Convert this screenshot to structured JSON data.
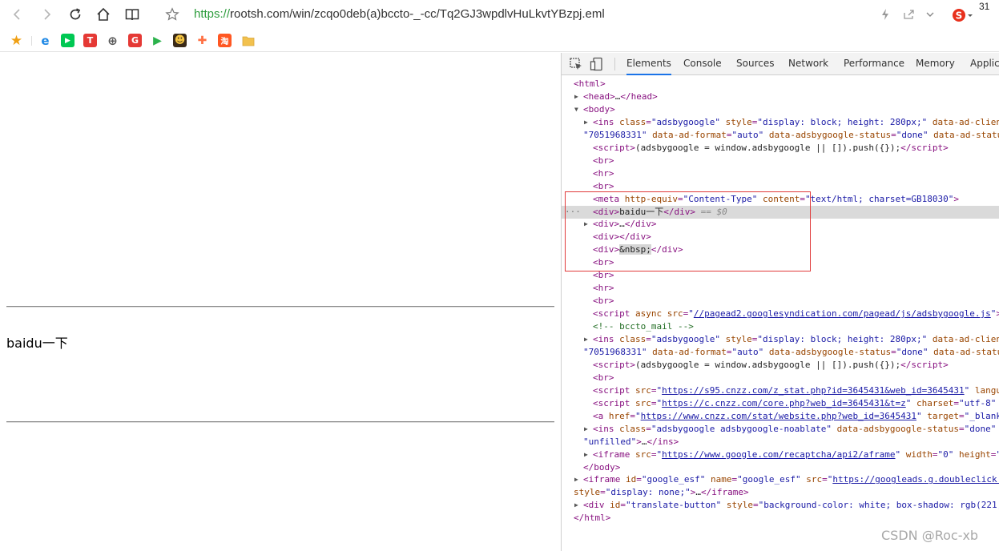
{
  "toolbar": {
    "url_scheme": "https://",
    "url_rest": "rootsh.com/win/zcqo0deb(a)bccto-_-cc/Tq2GJ3wpdlvHuLkvtYBzpj.eml",
    "date_fragment": "31",
    "icons": [
      "back-icon",
      "forward-icon",
      "reload-icon",
      "home-icon",
      "reader-icon",
      "star-icon",
      "lightning-icon",
      "share-icon",
      "chevron-down-icon",
      "sogou-icon"
    ]
  },
  "bookmarks": {
    "items": [
      {
        "name": "favorites-star",
        "glyph": "★",
        "color": "#f0a014"
      },
      {
        "name": "ie-icon",
        "glyph": "e",
        "color": "#1e88e5"
      },
      {
        "name": "iqiyi-icon",
        "glyph": "▶",
        "color": "#00c853"
      },
      {
        "name": "toutiao-icon",
        "glyph": "T",
        "color": "#e53935"
      },
      {
        "name": "globe-icon",
        "glyph": "⊕",
        "color": "#666666"
      },
      {
        "name": "game-g-icon",
        "glyph": "G",
        "color": "#e53935"
      },
      {
        "name": "video-play-icon",
        "glyph": "▶",
        "color": "#2bb24c"
      },
      {
        "name": "game-face-icon",
        "glyph": "☻",
        "color": "#3a2a18"
      },
      {
        "name": "gamepad-icon",
        "glyph": "✚",
        "color": "#ff7043"
      },
      {
        "name": "taobao-icon",
        "glyph": "淘",
        "color": "#ff5722"
      },
      {
        "name": "folder-icon",
        "glyph": "▬",
        "color": "#f2c14e"
      }
    ]
  },
  "page": {
    "text": "baidu一下"
  },
  "devtools": {
    "tabs": [
      "Elements",
      "Console",
      "Sources",
      "Network",
      "Performance",
      "Memory",
      "Applica"
    ],
    "active_tab": "Elements"
  },
  "watermark": "CSDN @Roc-xb"
}
